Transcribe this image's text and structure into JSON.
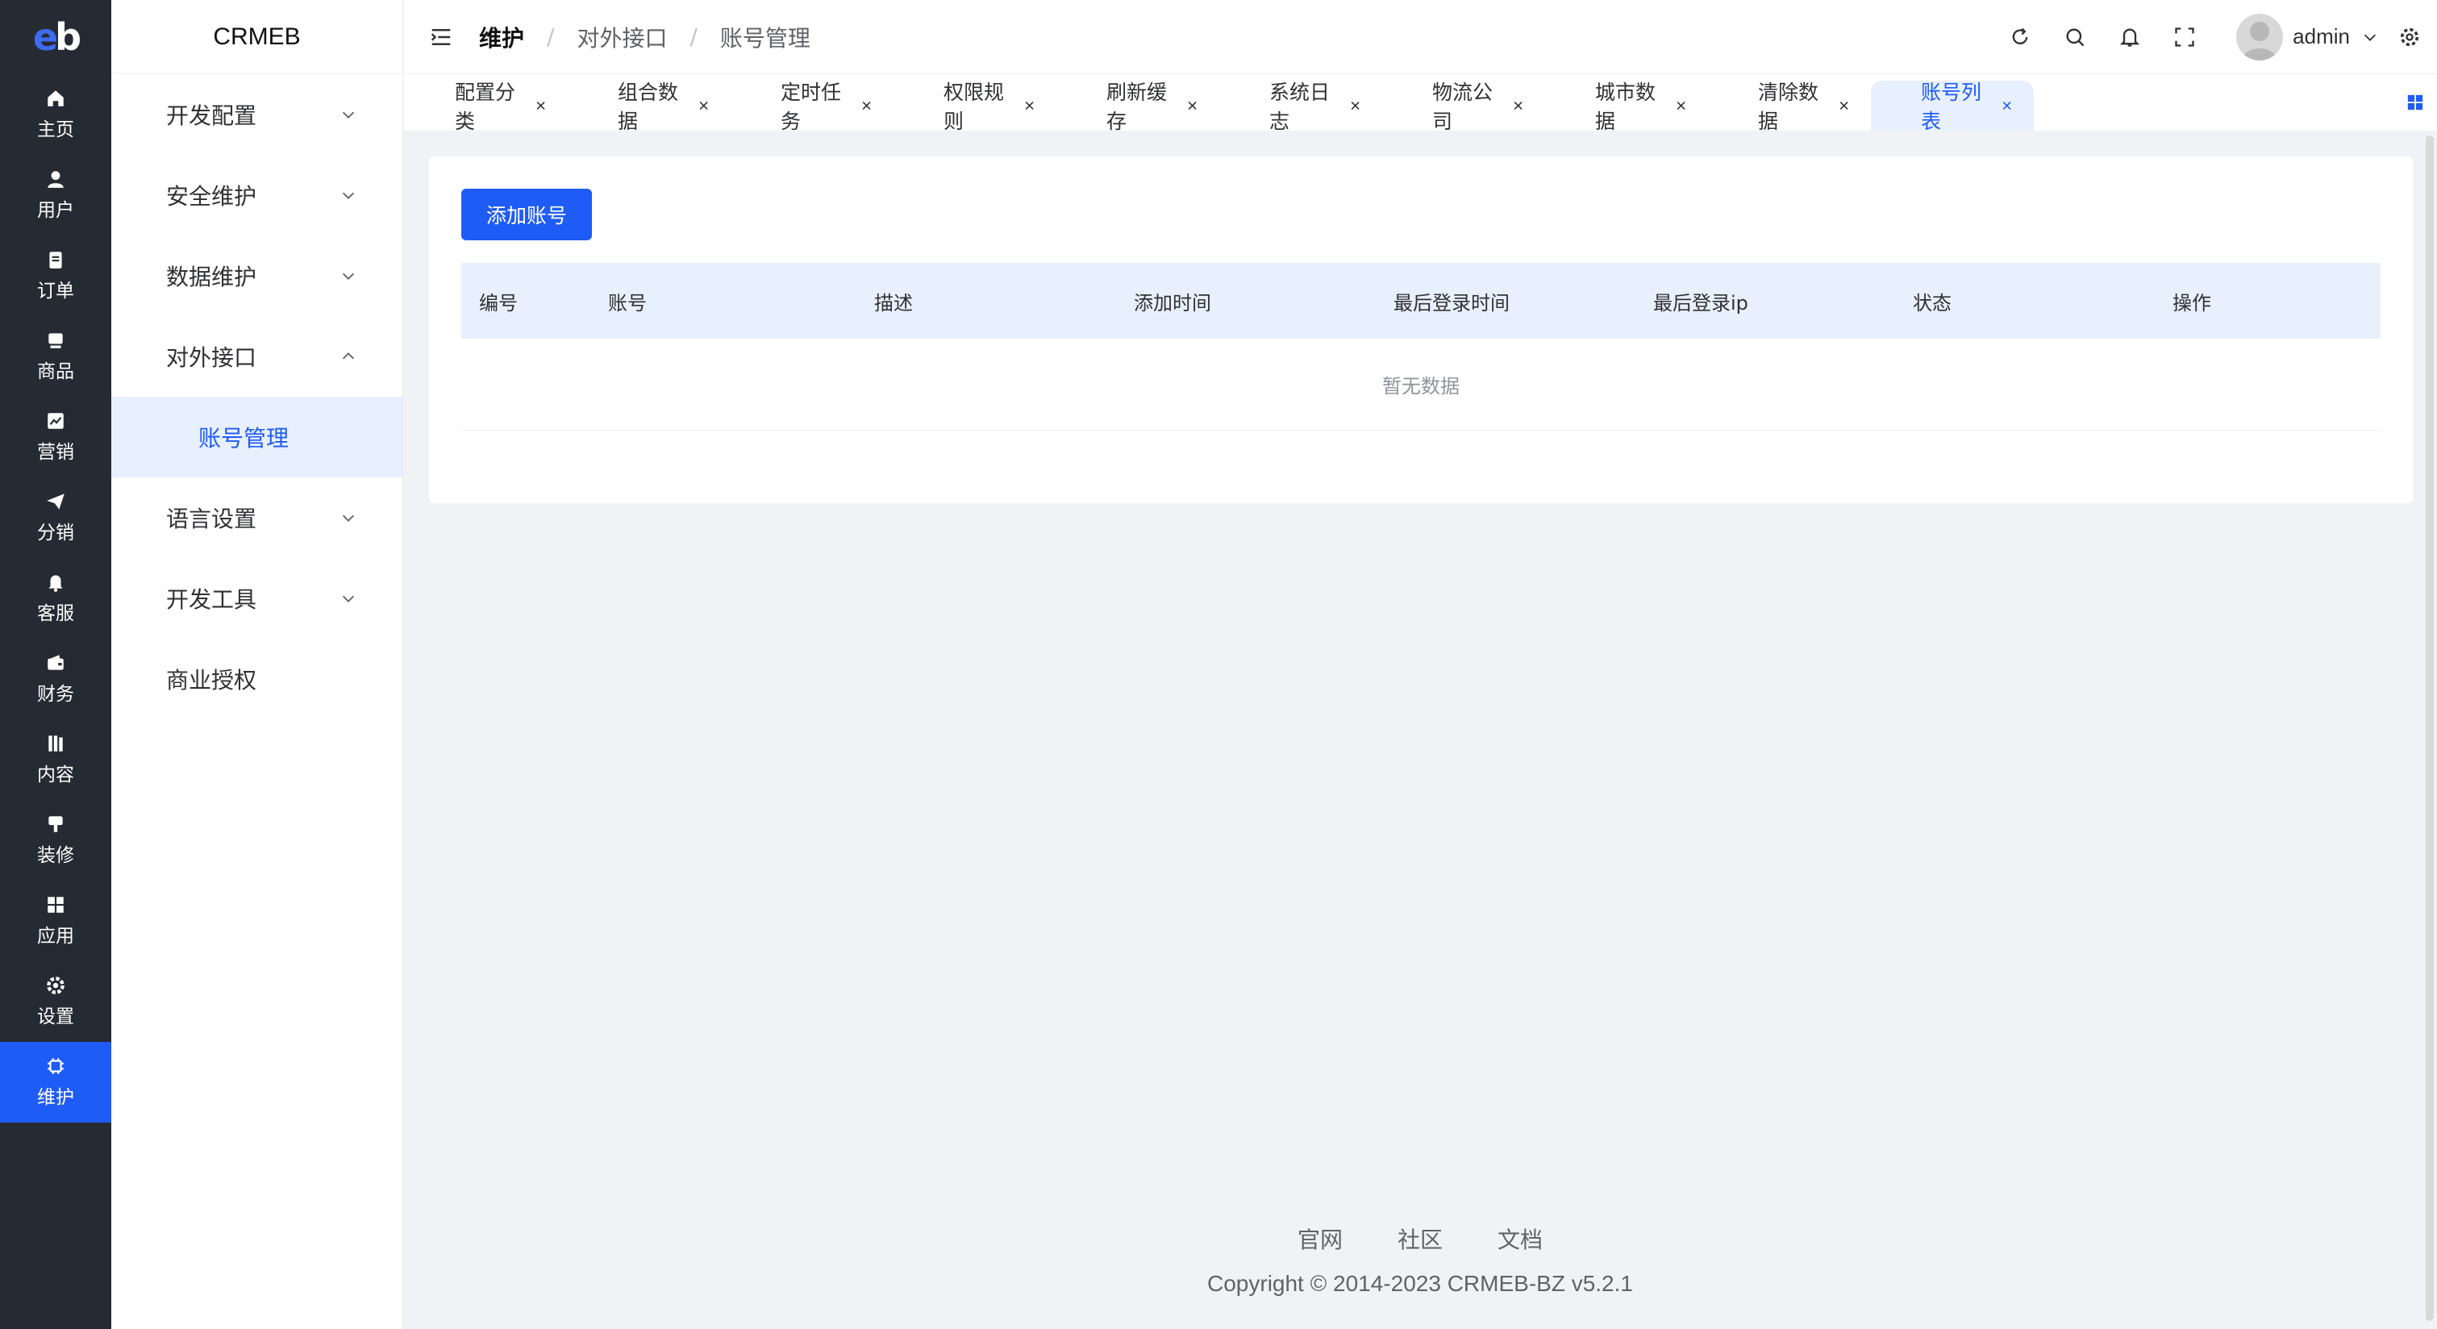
{
  "rail": {
    "items": [
      {
        "label": "主页",
        "icon": "home-icon"
      },
      {
        "label": "用户",
        "icon": "user-icon"
      },
      {
        "label": "订单",
        "icon": "order-icon"
      },
      {
        "label": "商品",
        "icon": "goods-icon"
      },
      {
        "label": "营销",
        "icon": "marketing-icon"
      },
      {
        "label": "分销",
        "icon": "send-icon"
      },
      {
        "label": "客服",
        "icon": "bell-icon"
      },
      {
        "label": "财务",
        "icon": "wallet-icon"
      },
      {
        "label": "内容",
        "icon": "book-icon"
      },
      {
        "label": "装修",
        "icon": "brush-icon"
      },
      {
        "label": "应用",
        "icon": "grid-icon"
      },
      {
        "label": "设置",
        "icon": "gear-icon"
      },
      {
        "label": "维护",
        "icon": "chip-icon"
      }
    ],
    "active_index": 12
  },
  "submenu": {
    "brand": "CRMEB",
    "items": [
      {
        "label": "开发配置"
      },
      {
        "label": "安全维护"
      },
      {
        "label": "数据维护"
      },
      {
        "label": "对外接口"
      },
      {
        "label": "账号管理"
      },
      {
        "label": "语言设置"
      },
      {
        "label": "开发工具"
      },
      {
        "label": "商业授权"
      }
    ]
  },
  "breadcrumb": {
    "c1": "维护",
    "c2": "对外接口",
    "c3": "账号管理",
    "sep": "/"
  },
  "user": {
    "name": "admin"
  },
  "tabs": [
    {
      "label": "配置分类"
    },
    {
      "label": "组合数据"
    },
    {
      "label": "定时任务"
    },
    {
      "label": "权限规则"
    },
    {
      "label": "刷新缓存"
    },
    {
      "label": "系统日志"
    },
    {
      "label": "物流公司"
    },
    {
      "label": "城市数据"
    },
    {
      "label": "清除数据"
    },
    {
      "label": "账号列表"
    }
  ],
  "content": {
    "add_button": "添加账号",
    "columns": [
      "编号",
      "账号",
      "描述",
      "添加时间",
      "最后登录时间",
      "最后登录ip",
      "状态",
      "操作"
    ],
    "empty_text": "暂无数据"
  },
  "footer": {
    "links": [
      "官网",
      "社区",
      "文档"
    ],
    "copyright": "Copyright © 2014-2023 CRMEB-BZ v5.2.1"
  },
  "colors": {
    "accent": "#1f5cf5",
    "rail_bg": "#262a33",
    "active_bg": "#e8f0fe"
  }
}
